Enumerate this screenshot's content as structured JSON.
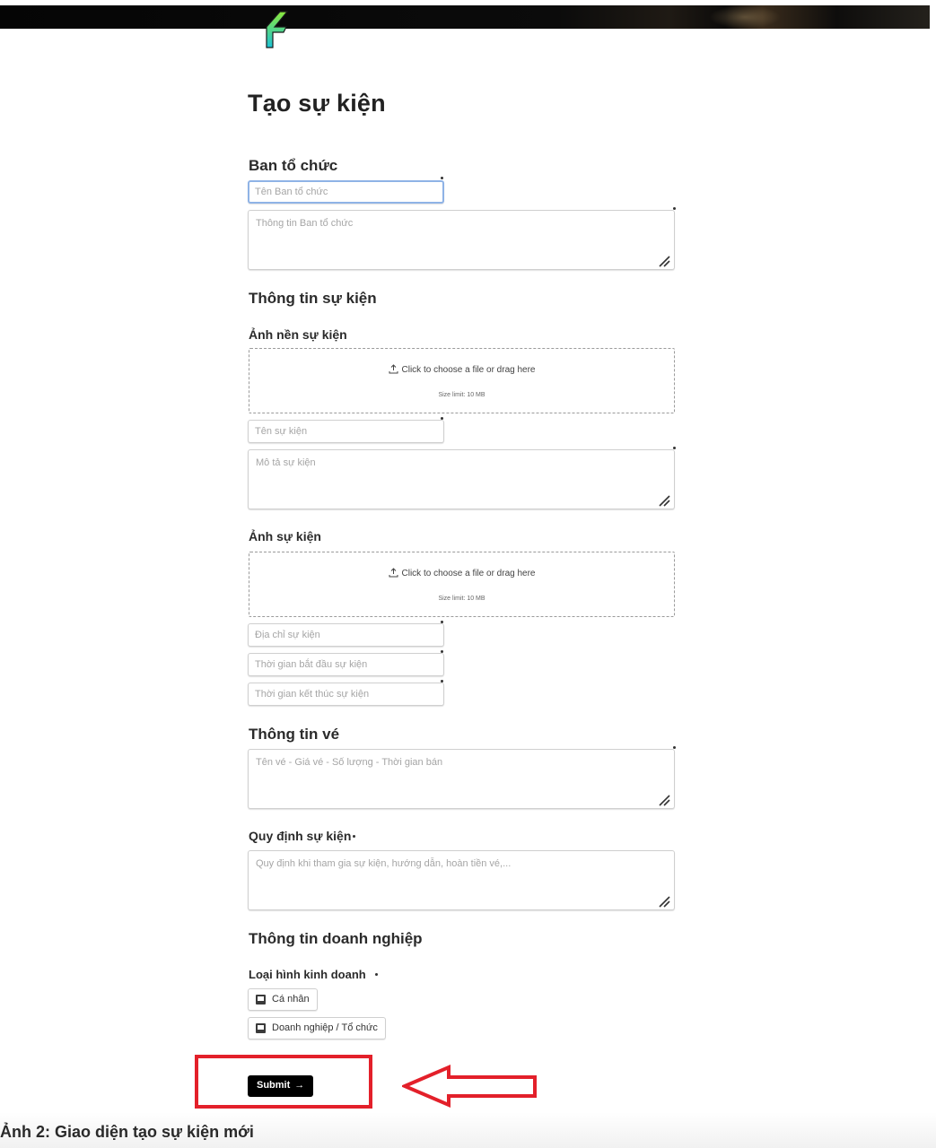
{
  "page": {
    "title": "Tạo sự kiện"
  },
  "organizer": {
    "section_title": "Ban tổ chức",
    "name_placeholder": "Tên Ban tổ chức",
    "info_placeholder": "Thông tin Ban tổ chức"
  },
  "event_info": {
    "section_title": "Thông tin sự kiện",
    "cover_label": "Ảnh nền sự kiện",
    "cover_upload_text": "Click to choose a file or drag here",
    "cover_upload_limit": "Size limit: 10 MB",
    "name_placeholder": "Tên sự kiện",
    "description_placeholder": "Mô tả sự kiện",
    "images_label": "Ảnh sự kiện",
    "images_upload_text": "Click to choose a file or drag here",
    "images_upload_limit": "Size limit: 10 MB",
    "address_placeholder": "Địa chỉ sự kiện",
    "start_time_placeholder": "Thời gian bắt đầu sự kiện",
    "end_time_placeholder": "Thời gian kết thúc sự kiện"
  },
  "ticket_info": {
    "section_title": "Thông tin vé",
    "tickets_placeholder": "Tên vé - Giá vé - Số lượng - Thời gian bán"
  },
  "rules": {
    "label": "Quy định sự kiện",
    "placeholder": "Quy định khi tham gia sự kiện, hướng dẫn, hoàn tiền vé,..."
  },
  "business_info": {
    "section_title": "Thông tin doanh nghiệp",
    "type_label": "Loại hình kinh doanh",
    "options": [
      "Cá nhân",
      "Doanh nghiệp / Tổ chức"
    ]
  },
  "actions": {
    "submit_label": "Submit",
    "submit_arrow": "→"
  },
  "caption": {
    "text": "Ảnh 2: Giao diện tạo sự kiện mới"
  },
  "colors": {
    "highlight": "#e3202a",
    "logo_green": "#7ee03a",
    "logo_cyan": "#22c8d8",
    "focus_border": "#8fb3e6"
  },
  "icons": {
    "upload": "upload-icon",
    "logo": "app-logo",
    "resize": "resize-handle-icon",
    "radio_option": "option-icon"
  }
}
